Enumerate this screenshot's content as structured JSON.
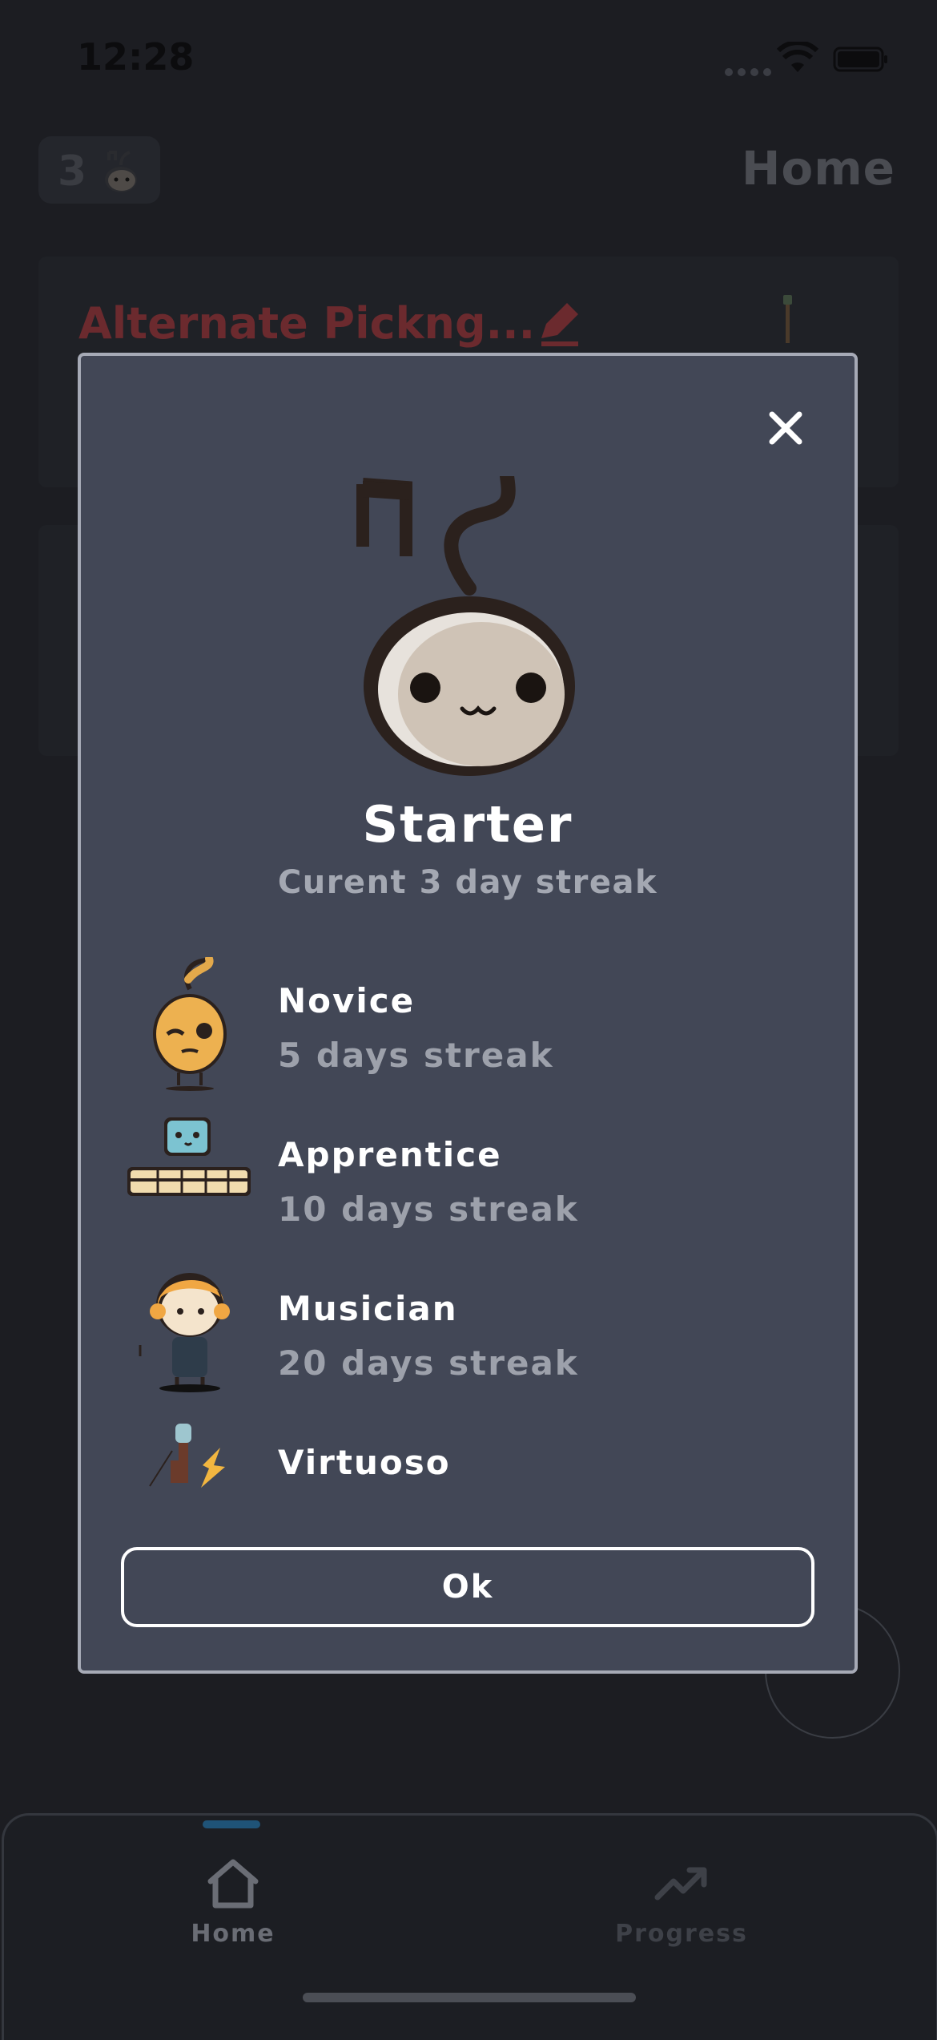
{
  "status_bar": {
    "time": "12:28"
  },
  "header": {
    "streak_count": "3",
    "title": "Home"
  },
  "background_cards": [
    {
      "title": "Alternate Pickng..."
    }
  ],
  "modal": {
    "title": "Starter",
    "subtitle": "Curent 3 day streak",
    "levels": [
      {
        "name": "Novice",
        "requirement": "5 days streak",
        "icon": "novice-mascot-icon"
      },
      {
        "name": "Apprentice",
        "requirement": "10 days streak",
        "icon": "apprentice-mascot-icon"
      },
      {
        "name": "Musician",
        "requirement": "20 days streak",
        "icon": "musician-mascot-icon"
      },
      {
        "name": "Virtuoso",
        "requirement": "",
        "icon": "virtuoso-guitar-icon"
      }
    ],
    "ok_label": "Ok"
  },
  "bottom_nav": {
    "items": [
      {
        "label": "Home",
        "icon": "home-icon",
        "active": true
      },
      {
        "label": "Progress",
        "icon": "trending-up-icon",
        "active": false
      }
    ]
  },
  "colors": {
    "modal_bg": "#424756",
    "modal_border": "#a6aab6",
    "app_bg": "#1c1d22",
    "card_title_red": "#6b2a2e",
    "nav_indicator": "#1f5377"
  }
}
